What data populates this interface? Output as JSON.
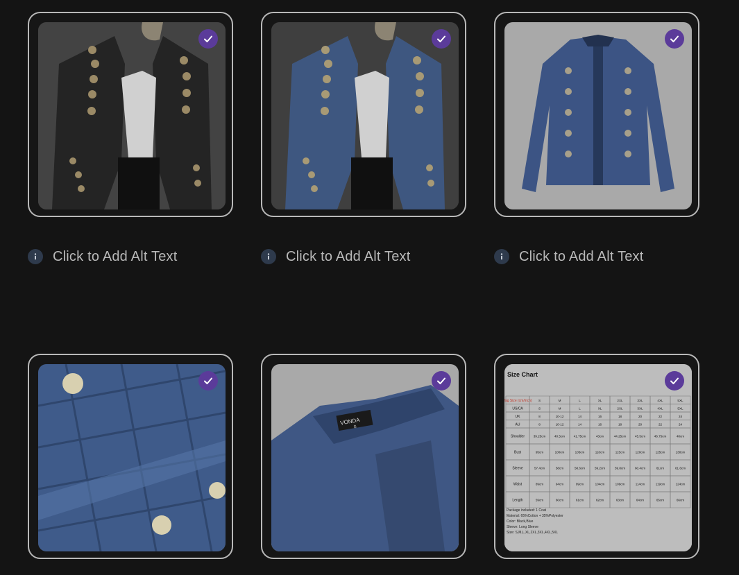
{
  "gallery": {
    "items": [
      {
        "id": "img-1",
        "alt_prompt": "Click to Add Alt Text",
        "selected": true,
        "subject": "black-jacket-worn"
      },
      {
        "id": "img-2",
        "alt_prompt": "Click to Add Alt Text",
        "selected": true,
        "subject": "blue-jacket-worn"
      },
      {
        "id": "img-3",
        "alt_prompt": "Click to Add Alt Text",
        "selected": true,
        "subject": "blue-jacket-flat"
      },
      {
        "id": "img-4",
        "alt_prompt": "",
        "selected": true,
        "subject": "fabric-button-closeup"
      },
      {
        "id": "img-5",
        "alt_prompt": "",
        "selected": true,
        "subject": "collar-label-closeup"
      },
      {
        "id": "img-6",
        "alt_prompt": "",
        "selected": true,
        "subject": "size-chart"
      }
    ]
  },
  "collar_label": {
    "brand": "VONDA",
    "size": "S"
  },
  "size_chart": {
    "title": "Size Chart",
    "headers": [
      "Tag Size (cm/inch)",
      "S",
      "M",
      "L",
      "XL",
      "2XL",
      "3XL",
      "4XL",
      "5XL"
    ],
    "rows": [
      [
        "US/CA",
        "S",
        "M",
        "L",
        "XL",
        "2XL",
        "3XL",
        "4XL",
        "5XL"
      ],
      [
        "UK",
        "8",
        "10-12",
        "14",
        "16",
        "18",
        "20",
        "22",
        "24"
      ],
      [
        "AU",
        "8",
        "10-12",
        "14",
        "16",
        "18",
        "20",
        "22",
        "24"
      ],
      [
        "Shoulder",
        "39.25cm",
        "40.5cm",
        "41.75cm",
        "43cm",
        "44.25cm",
        "45.5cm",
        "46.75cm",
        "48cm"
      ],
      [
        "Bust",
        "95cm",
        "100cm",
        "105cm",
        "110cm",
        "115cm",
        "120cm",
        "125cm",
        "130cm"
      ],
      [
        "Sleeve",
        "57.4cm",
        "58cm",
        "58.6cm",
        "59.2cm",
        "59.8cm",
        "60.4cm",
        "61cm",
        "61.6cm"
      ],
      [
        "Waist",
        "89cm",
        "94cm",
        "99cm",
        "104cm",
        "109cm",
        "114cm",
        "119cm",
        "124cm"
      ],
      [
        "Length",
        "59cm",
        "60cm",
        "61cm",
        "62cm",
        "63cm",
        "64cm",
        "65cm",
        "66cm"
      ]
    ],
    "notes": [
      "Package included: 1 Coat",
      "Material: 65%Cotton + 35%Polyester",
      "Color: Black,Blue",
      "Sleeve: Long Sleeve",
      "Size: S,M,L,XL,2XL,3XL,4XL,5XL"
    ]
  },
  "colors": {
    "background": "#141414",
    "card_border": "#b9b9b9",
    "check_badge": "#5b3b9a",
    "info_badge": "#2e3a4c",
    "alt_text": "#b8b8b8"
  }
}
